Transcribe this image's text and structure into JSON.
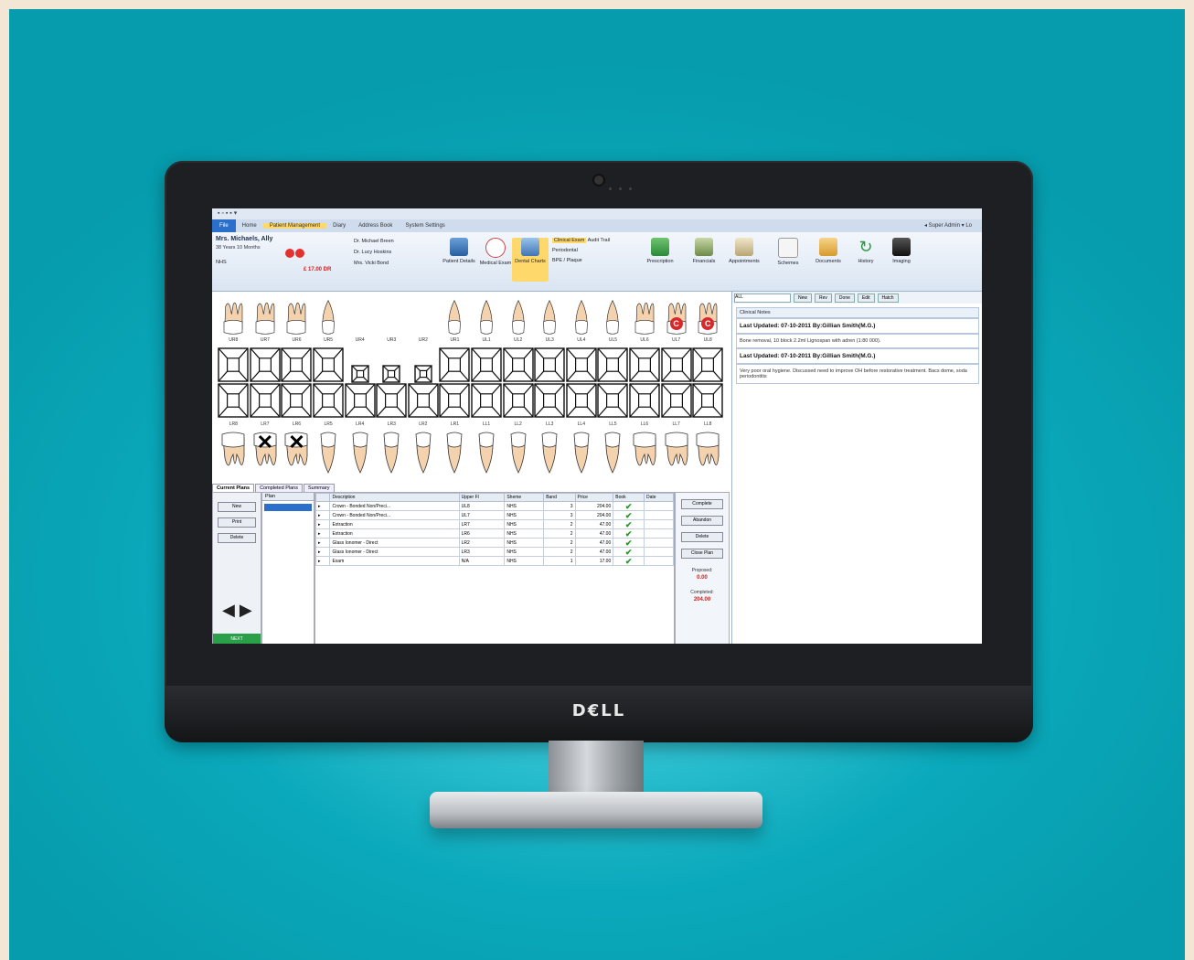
{
  "app": {
    "quick_access": "▪ ▫ ▪ ▪ ▾",
    "tabs": [
      "File",
      "Home",
      "Patient Management",
      "Diary",
      "Address Book",
      "System Settings"
    ],
    "user": "◂ Super Admin ▾ Lo"
  },
  "patient": {
    "name": "Mrs. Michaels, Ally",
    "age": "38 Years 10 Months",
    "nhs": "NHS",
    "balance": "£ 17.00 DR",
    "dentists": [
      "Dr. Michael Breen",
      "Dr. Lucy Hoskins",
      "Mrs. Vicki Bond"
    ]
  },
  "ribbon": {
    "patient_details": "Patient Details",
    "medical_exam": "Medical Exam",
    "dental_charts": "Dental Charts",
    "clinical_exam": "Clinical Exam",
    "audit_trail": "Audit Trail",
    "periodontal": "Periodontal",
    "bpe": "BPE / Plaque",
    "prescription": "Prescription",
    "financials": "Financials",
    "appointments": "Appointments",
    "schemes": "Schemes",
    "documents": "Documents",
    "history": "History",
    "imaging": "Imaging"
  },
  "chart": {
    "upper_labels": [
      "UR8",
      "UR7",
      "UR6",
      "UR5",
      "UR4",
      "UR3",
      "UR2",
      "UR1",
      "UL1",
      "UL2",
      "UL3",
      "UL4",
      "UL5",
      "UL6",
      "UL7",
      "UL8"
    ],
    "lower_labels": [
      "LR8",
      "LR7",
      "LR6",
      "LR5",
      "LR4",
      "LR3",
      "LR2",
      "LR1",
      "LL1",
      "LL2",
      "LL3",
      "LL4",
      "LL5",
      "LL6",
      "LL7",
      "LL8"
    ],
    "crown_mark": "C",
    "extract_mark": "✕"
  },
  "notes": {
    "filter": "ALL",
    "buttons": [
      "New",
      "Rev",
      "Done",
      "Edit",
      "Hatch"
    ],
    "header": "Clinical Notes",
    "entries": [
      {
        "updated": "Last Updated: 07-10-2011 By:Gillian Smith(M.G.)",
        "text": "Bone removal, 10 block 2.2ml Lignospan with adren (1:80 000)."
      },
      {
        "updated": "Last Updated: 07-10-2011 By:Gillian Smith(M.G.)",
        "text": "Very poor oral hygiene. Discussed need to improve OH before restorative treatment. Bacs dome, soda periodontitis"
      }
    ]
  },
  "plans": {
    "tabs": [
      "Current Plans",
      "Completed Plans",
      "Summary"
    ],
    "left_buttons": [
      "New",
      "Print",
      "Delete"
    ],
    "arrows": "◀ ▶",
    "next_label": "NEXT",
    "plan_header": "Plan",
    "columns": [
      "Description",
      "Upper Fl",
      "Sheme",
      "Band",
      "Price",
      "Book",
      "Date"
    ],
    "rows": [
      [
        "Crown - Bonded Non/Preci...",
        "UL8",
        "NHS",
        "3",
        "204.00",
        "✔",
        ""
      ],
      [
        "Crown - Bonded Non/Preci...",
        "UL7",
        "NHS",
        "3",
        "204.00",
        "✔",
        ""
      ],
      [
        "Extraction",
        "LR7",
        "NHS",
        "2",
        "47.00",
        "✔",
        ""
      ],
      [
        "Extraction",
        "LR6",
        "NHS",
        "2",
        "47.00",
        "✔",
        ""
      ],
      [
        "Glass Ionomer - Direct",
        "LR2",
        "NHS",
        "2",
        "47.00",
        "✔",
        ""
      ],
      [
        "Glass Ionomer - Direct",
        "LR3",
        "NHS",
        "2",
        "47.00",
        "✔",
        ""
      ],
      [
        "Exam",
        "N/A",
        "NHS",
        "1",
        "17.00",
        "✔",
        ""
      ]
    ],
    "right_buttons": [
      "Complete",
      "Abandon",
      "Delete",
      "Close Plan"
    ],
    "proposed_label": "Proposed:",
    "proposed_value": "0.00",
    "completed_label": "Completed:",
    "completed_value": "204.00"
  },
  "monitor": {
    "brand": "D€LL"
  }
}
